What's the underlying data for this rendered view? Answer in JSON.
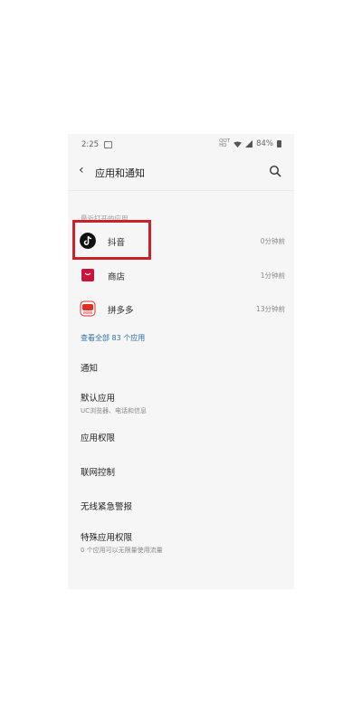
{
  "status": {
    "time": "2:25",
    "battery": "84%",
    "nfc_label": "QOT\nHD",
    "icons": [
      "image-icon",
      "wifi-icon",
      "signal-icon",
      "battery-icon"
    ]
  },
  "header": {
    "title": "应用和通知",
    "back_icon": "back-arrow-icon",
    "search_icon": "search-icon"
  },
  "recent": {
    "label": "最近打开的应用",
    "apps": [
      {
        "name": "抖音",
        "time": "0分钟前",
        "icon": "tiktok-icon"
      },
      {
        "name": "商店",
        "time": "1分钟前",
        "icon": "store-icon"
      },
      {
        "name": "拼多多",
        "time": "13分钟前",
        "icon": "pinduoduo-icon"
      }
    ],
    "see_all": "查看全部 83 个应用"
  },
  "settings": [
    {
      "title": "通知",
      "subtitle": ""
    },
    {
      "title": "默认应用",
      "subtitle": "UC浏览器、电话和信息"
    },
    {
      "title": "应用权限",
      "subtitle": ""
    },
    {
      "title": "联网控制",
      "subtitle": ""
    },
    {
      "title": "无线紧急警报",
      "subtitle": ""
    },
    {
      "title": "特殊应用权限",
      "subtitle": "0 个应用可以无限量使用流量"
    }
  ],
  "colors": {
    "highlight": "#c8232c",
    "link": "#2a6fa8",
    "store": "#c8143c",
    "pdd": "#e02e24"
  }
}
